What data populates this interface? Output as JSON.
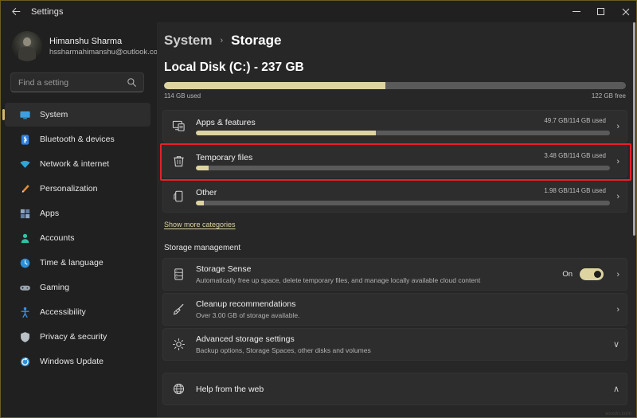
{
  "window": {
    "title": "Settings",
    "back_icon": "back-arrow-icon",
    "minimize_label": "Minimize",
    "maximize_label": "Maximize",
    "close_label": "Close"
  },
  "sidebar": {
    "account": {
      "name": "Himanshu Sharma",
      "email": "hssharmahimanshu@outlook.com",
      "avatar_icon": "user-avatar"
    },
    "search": {
      "placeholder": "Find a setting",
      "value": "",
      "icon": "search-icon"
    },
    "items": [
      {
        "label": "System",
        "icon": "display-icon",
        "color": "#3ca0e0",
        "active": true
      },
      {
        "label": "Bluetooth & devices",
        "icon": "bluetooth-icon",
        "color": "#2f7fe8",
        "active": false
      },
      {
        "label": "Network & internet",
        "icon": "wifi-icon",
        "color": "#31a5d6",
        "active": false
      },
      {
        "label": "Personalization",
        "icon": "brush-icon",
        "color": "#e08a3c",
        "active": false
      },
      {
        "label": "Apps",
        "icon": "apps-icon",
        "color": "#6f8fb5",
        "active": false
      },
      {
        "label": "Accounts",
        "icon": "account-icon",
        "color": "#2ec4a6",
        "active": false
      },
      {
        "label": "Time & language",
        "icon": "clock-icon",
        "color": "#2f8fd6",
        "active": false
      },
      {
        "label": "Gaming",
        "icon": "gamepad-icon",
        "color": "#9aa4ad",
        "active": false
      },
      {
        "label": "Accessibility",
        "icon": "person-icon",
        "color": "#3b8fe0",
        "active": false
      },
      {
        "label": "Privacy & security",
        "icon": "shield-icon",
        "color": "#b9c0c6",
        "active": false
      },
      {
        "label": "Windows Update",
        "icon": "update-icon",
        "color": "#2f8fd6",
        "active": false
      }
    ]
  },
  "main": {
    "breadcrumb": {
      "parent": "System",
      "separator": "›",
      "current": "Storage"
    },
    "disk": {
      "title": "Local Disk (C:) - 237 GB",
      "used_label": "114 GB used",
      "free_label": "122 GB free",
      "used_percent": 48
    },
    "categories": [
      {
        "name": "Apps & features",
        "icon": "apps-features-icon",
        "amount": "49.7 GB/114 GB used",
        "percent": 43.5,
        "chevron": "›",
        "highlighted": false
      },
      {
        "name": "Temporary files",
        "icon": "trash-icon",
        "amount": "3.48 GB/114 GB used",
        "percent": 3.1,
        "chevron": "›",
        "highlighted": true
      },
      {
        "name": "Other",
        "icon": "document-icon",
        "amount": "1.98 GB/114 GB used",
        "percent": 2.0,
        "chevron": "›",
        "highlighted": false
      }
    ],
    "show_more_label": "Show more categories",
    "management_heading": "Storage management",
    "management": [
      {
        "title": "Storage Sense",
        "subtitle": "Automatically free up space, delete temporary files, and manage locally available cloud content",
        "icon": "storage-sense-icon",
        "toggle_label": "On",
        "toggle_on": true,
        "chevron": "›"
      },
      {
        "title": "Cleanup recommendations",
        "subtitle": "Over 3.00 GB of storage available.",
        "icon": "broom-icon",
        "toggle_label": "",
        "toggle_on": false,
        "chevron": "›"
      },
      {
        "title": "Advanced storage settings",
        "subtitle": "Backup options, Storage Spaces, other disks and volumes",
        "icon": "gear-icon",
        "toggle_label": "",
        "toggle_on": false,
        "chevron": "∨"
      }
    ],
    "help": {
      "title": "Help from the web",
      "icon": "globe-icon",
      "chevron": "∧"
    }
  },
  "accent": {
    "progress_fill": "#ddd4a1",
    "progress_track": "#5a5a5a",
    "highlight_border": "#e8202a",
    "link": "#ddd4a1"
  },
  "watermark": {
    "text": "wsxdn.com"
  }
}
